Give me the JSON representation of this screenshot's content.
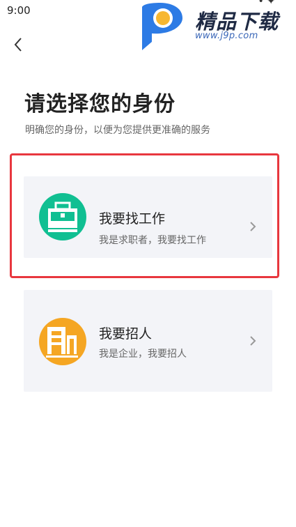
{
  "status_bar": {
    "time": "9:00",
    "extra": "•  ✦"
  },
  "watermark": {
    "title": "精品下载",
    "url": "www.j9p.com"
  },
  "header": {
    "back_icon": "chevron-left-icon"
  },
  "page": {
    "title": "请选择您的身份",
    "subtitle": "明确您的身份，以便为您提供更准确的服务"
  },
  "roles": [
    {
      "title": "我要找工作",
      "description": "我是求职者，我要找工作",
      "icon": "briefcase-icon",
      "color": "#10bf92",
      "highlighted": true
    },
    {
      "title": "我要招人",
      "description": "我是企业，我要招人",
      "icon": "building-icon",
      "color": "#f5a623",
      "highlighted": false
    }
  ],
  "colors": {
    "highlight": "#e8373e",
    "card_bg": "#f3f4f8"
  }
}
